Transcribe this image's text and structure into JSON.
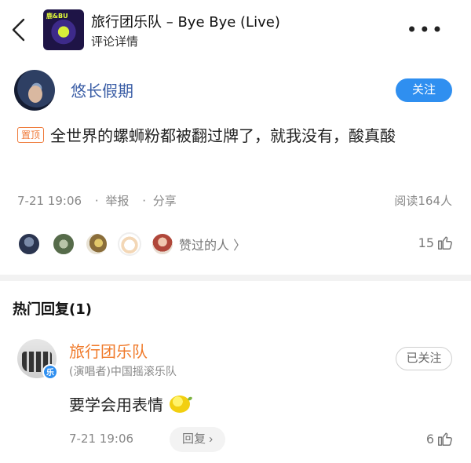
{
  "header": {
    "song_title": "旅行团乐队 – Bye Bye (Live)",
    "subtitle": "评论详情",
    "cover_text": "鹿&BU",
    "more_label": "•••"
  },
  "comment": {
    "username": "悠长假期",
    "follow_label": "关注",
    "pin_label": "置顶",
    "text": "全世界的螺蛳粉都被翻过牌了，就我没有，酸真酸",
    "time": "7-21 19:06",
    "report_label": "举报",
    "share_label": "分享",
    "dot": "·",
    "read_count": "阅读164人",
    "likers_label": "赞过的人",
    "likers_chevron": "〉",
    "like_count": "15"
  },
  "replies": {
    "title": "热门回复(1)",
    "items": [
      {
        "username": "旅行团乐队",
        "tag": "(演唱者)中国摇滚乐队",
        "badge": "乐",
        "followed_label": "已关注",
        "text": "要学会用表情",
        "time": "7-21 19:06",
        "reply_label": "回复 ›",
        "like_count": "6"
      }
    ]
  },
  "colors": {
    "accent_blue": "#2f8ff0",
    "username_blue": "#3b5ea6",
    "artist_orange": "#f07a2a"
  }
}
